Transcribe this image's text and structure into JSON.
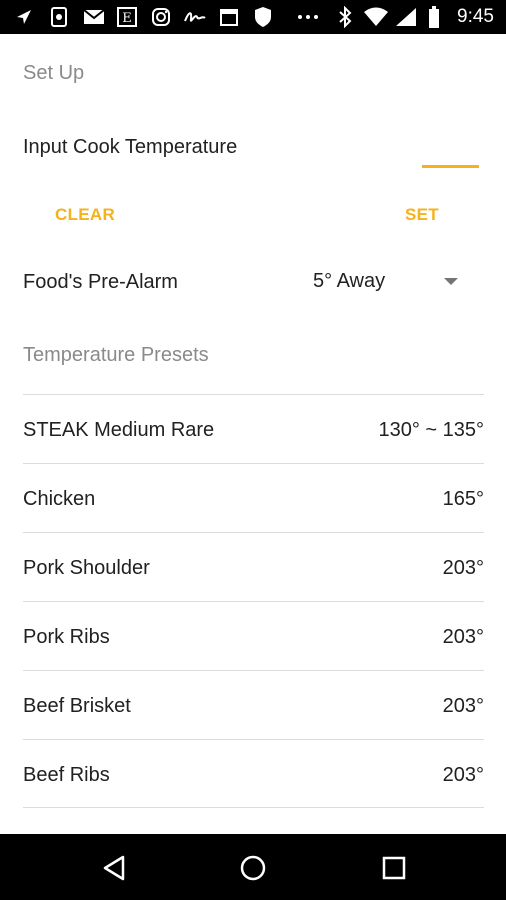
{
  "status_bar": {
    "time": "9:45",
    "left_icons": [
      "navigation-icon",
      "app-icon",
      "gmail-icon",
      "e-app-icon",
      "instagram-icon",
      "signature-icon",
      "calendar-icon",
      "shield-icon",
      "more-icon"
    ],
    "right_icons": [
      "bluetooth-icon",
      "wifi-icon",
      "signal-icon",
      "battery-icon"
    ]
  },
  "setup": {
    "section_title": "Set Up",
    "input_label": "Input Cook Temperature",
    "input_value": "",
    "clear_label": "CLEAR",
    "set_label": "SET",
    "pre_alarm_label": "Food's Pre-Alarm",
    "pre_alarm_value": "5° Away"
  },
  "presets": {
    "section_title": "Temperature Presets",
    "items": [
      {
        "name": "STEAK Medium Rare",
        "temp": "130° ~ 135°"
      },
      {
        "name": "Chicken",
        "temp": "165°"
      },
      {
        "name": "Pork Shoulder",
        "temp": "203°"
      },
      {
        "name": "Pork Ribs",
        "temp": "203°"
      },
      {
        "name": "Beef Brisket",
        "temp": "203°"
      },
      {
        "name": "Beef Ribs",
        "temp": "203°"
      }
    ]
  },
  "nav_bar": {
    "buttons": [
      "back-icon",
      "home-icon",
      "recents-icon"
    ]
  },
  "colors": {
    "accent": "#f5b21b",
    "section_gray": "#8a8a8a",
    "text": "#212121",
    "divider": "#dcdcdc",
    "bar_background": "#000000"
  }
}
